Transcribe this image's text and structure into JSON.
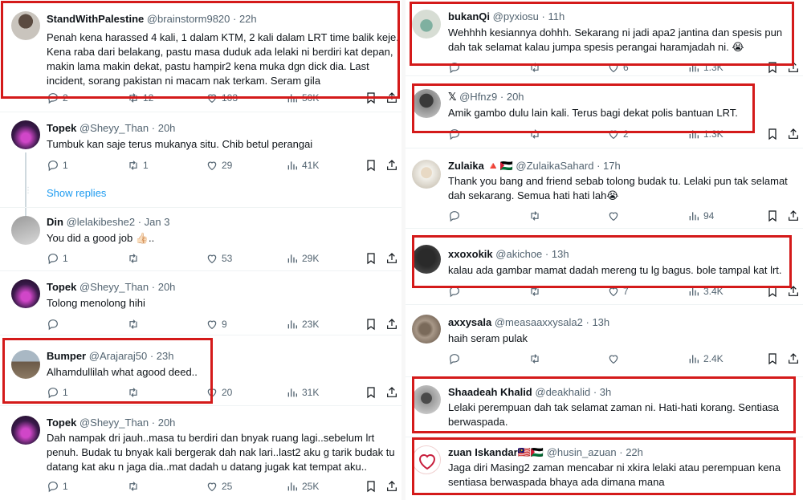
{
  "left_tweets": [
    {
      "name": "StandWithPalestine",
      "handle": "@brainstorm9820",
      "time": "· 22h",
      "text": "Penah kena harassed  4 kali, 1 dalam KTM, 2 kali dalam LRT time balik keje. Kena raba dari belakang, pastu masa duduk ada lelaki ni berdiri kat depan, makin lama makin dekat, pastu hampir2 kena muka dgn dick dia. Last incident, sorang pakistan ni macam nak terkam. Seram gila",
      "replies": "2",
      "retweets": "12",
      "likes": "103",
      "views": "50K"
    },
    {
      "name": "Topek",
      "handle": "@Sheyy_Than",
      "time": "· 20h",
      "text": "Tumbuk kan saje terus mukanya situ. Chib betul perangai",
      "replies": "1",
      "retweets": "1",
      "likes": "29",
      "views": "41K"
    },
    {
      "name": "Din",
      "handle": "@lelakibeshe2",
      "time": "· Jan 3",
      "text": "You did a good job 👍🏻..",
      "replies": "1",
      "retweets": "",
      "likes": "53",
      "views": "29K"
    },
    {
      "name": "Topek",
      "handle": "@Sheyy_Than",
      "time": "· 20h",
      "text": "Tolong menolong hihi",
      "replies": "",
      "retweets": "",
      "likes": "9",
      "views": "23K"
    },
    {
      "name": "Bumper",
      "handle": "@Arajaraj50",
      "time": "· 23h",
      "text": "Alhamdullilah what agood deed..",
      "replies": "1",
      "retweets": "",
      "likes": "20",
      "views": "31K"
    },
    {
      "name": "Topek",
      "handle": "@Sheyy_Than",
      "time": "· 20h",
      "text": "Dah nampak dri jauh..masa tu berdiri dan bnyak ruang lagi..sebelum lrt penuh. Budak tu bnyak kali bergerak dah nak lari..last2 aku g tarik budak tu datang kat aku n jaga dia..mat dadah u datang jugak kat tempat aku..",
      "replies": "1",
      "retweets": "",
      "likes": "25",
      "views": "25K"
    }
  ],
  "show_replies": "Show replies",
  "right_tweets": [
    {
      "name": "bukanQi",
      "handle": "@pyxiosu",
      "time": "· 11h",
      "text": "Wehhhh kesiannya dohhh. Sekarang ni jadi apa2 jantina dan spesis pun dah tak selamat kalau jumpa spesis perangai haramjadah ni. 😭",
      "replies": "",
      "retweets": "",
      "likes": "6",
      "views": "1.3K"
    },
    {
      "name": "𝕏",
      "handle": "@Hfnz9",
      "time": "· 20h",
      "text": "Amik gambo dulu lain kali. Terus bagi dekat polis bantuan LRT.",
      "replies": "",
      "retweets": "",
      "likes": "2",
      "views": "1.3K"
    },
    {
      "name": "Zulaika 🔺🇵🇸",
      "handle": "@ZulaikaSahard",
      "time": "· 17h",
      "text": "Thank you bang and friend sebab tolong budak tu. Lelaki pun tak selamat dah sekarang. Semua hati hati lah😭",
      "replies": "",
      "retweets": "",
      "likes": "",
      "views": "94"
    },
    {
      "name": "xxoxokik",
      "handle": "@akichoe",
      "time": "· 13h",
      "text": "kalau ada gambar mamat dadah mereng tu lg bagus. bole tampal kat lrt.",
      "replies": "",
      "retweets": "",
      "likes": "7",
      "views": "3.4K"
    },
    {
      "name": "axxysala",
      "handle": "@measaaxxysala2",
      "time": "· 13h",
      "text": "haih seram pulak",
      "replies": "",
      "retweets": "",
      "likes": "",
      "views": "2.4K"
    },
    {
      "name": "Shaadeah Khalid",
      "handle": "@deakhalid",
      "time": "· 3h",
      "text": "Lelaki perempuan dah tak selamat zaman ni. Hati-hati korang. Sentiasa berwaspada.",
      "replies": "",
      "retweets": "",
      "likes": "",
      "views": ""
    },
    {
      "name": "zuan Iskandar🇲🇾🇵🇸",
      "handle": "@husin_azuan",
      "time": "· 22h",
      "text": "Jaga diri Masing2 zaman mencabar ni xkira lelaki atau perempuan kena sentiasa berwaspada bhaya ada dimana mana",
      "replies": "",
      "retweets": "",
      "likes": "",
      "views": ""
    }
  ],
  "colors": {
    "highlight": "#d41a1a",
    "link": "#1d9bf0",
    "muted": "#536471"
  },
  "icons": [
    "reply-icon",
    "retweet-icon",
    "like-icon",
    "views-icon",
    "bookmark-icon",
    "share-icon"
  ]
}
